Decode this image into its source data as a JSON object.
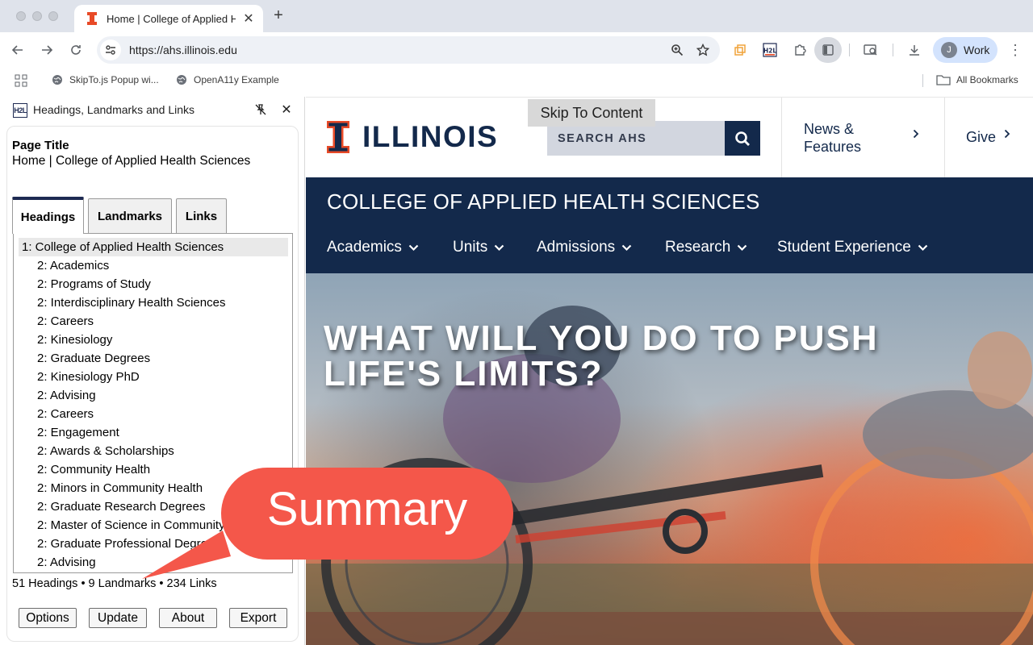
{
  "browser": {
    "tab_title": "Home | College of Applied Health Sciences",
    "url": "https://ahs.illinois.edu",
    "profile_initial": "J",
    "profile_label": "Work",
    "bookmarks": [
      "SkipTo.js Popup wi...",
      "OpenA11y Example"
    ],
    "all_bookmarks": "All Bookmarks"
  },
  "panel": {
    "logo_text": "H2L",
    "title": "Headings, Landmarks and Links",
    "page_title_label": "Page Title",
    "page_title_value": "Home | College of Applied Health Sciences",
    "tabs": [
      "Headings",
      "Landmarks",
      "Links"
    ],
    "headings": [
      "1: College of Applied Health Sciences",
      "2: Academics",
      "2: Programs of Study",
      "2: Interdisciplinary Health Sciences",
      "2: Careers",
      "2: Kinesiology",
      "2: Graduate Degrees",
      "2: Kinesiology PhD",
      "2: Advising",
      "2: Careers",
      "2: Engagement",
      "2: Awards & Scholarships",
      "2: Community Health",
      "2: Minors in Community Health",
      "2: Graduate Research Degrees",
      "2: Master of Science in Community Health",
      "2: Graduate Professional Degrees",
      "2: Advising"
    ],
    "summary": "51 Headings • 9 Landmarks • 234 Links",
    "buttons": [
      "Options",
      "Update",
      "About",
      "Export"
    ]
  },
  "site": {
    "wordmark": "ILLINOIS",
    "skip_link": "Skip To Content",
    "search_placeholder": "SEARCH AHS",
    "news_label": "News & Features",
    "give_label": "Give",
    "college_name": "COLLEGE OF APPLIED HEALTH SCIENCES",
    "nav": [
      "Academics",
      "Units",
      "Admissions",
      "Research",
      "Student Experience"
    ],
    "hero_line1": "WHAT WILL YOU DO TO PUSH",
    "hero_line2": "LIFE'S LIMITS?"
  },
  "callout": {
    "label": "Summary"
  },
  "colors": {
    "illinois_blue": "#13294b",
    "illinois_orange": "#e84a27",
    "callout": "#f4574a"
  }
}
